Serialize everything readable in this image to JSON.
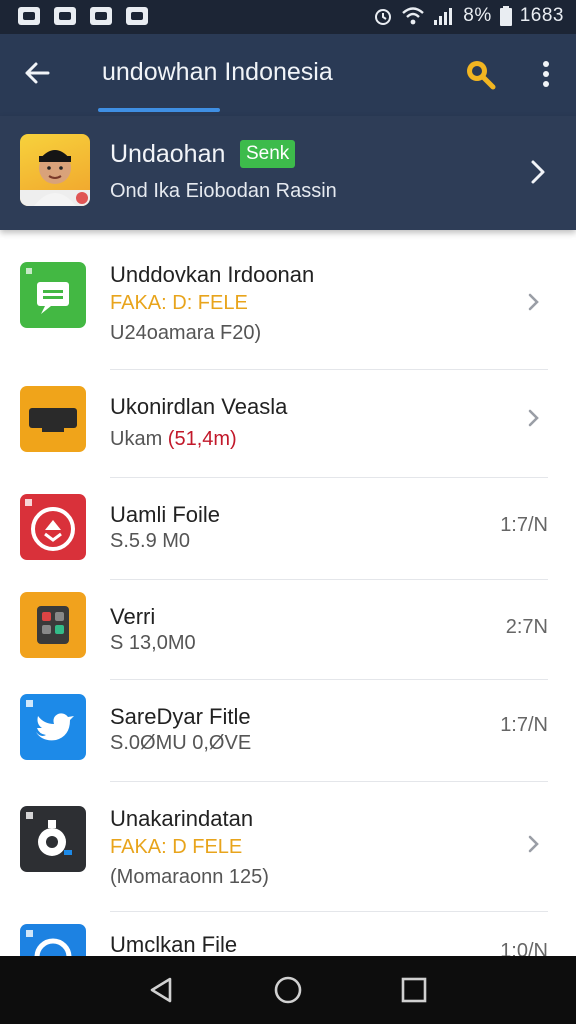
{
  "status_bar": {
    "battery": "8%",
    "time": "1683",
    "icons": [
      "notification-icon",
      "gallery-icon",
      "file-icon",
      "bag-icon",
      "alarm-icon",
      "wifi-icon",
      "signal-icon",
      "battery-icon"
    ]
  },
  "app_bar": {
    "title": "undowhan Indonesia",
    "back_icon": "arrow-left-icon",
    "search_icon": "search-icon",
    "more_icon": "more-vert-icon",
    "accent": "#3f8fe3"
  },
  "profile": {
    "name": "Undaohan",
    "badge": "Senk",
    "subtitle": "Ond Ika Eiobodan Rassin",
    "badge_color": "#3dbb4b"
  },
  "items": [
    {
      "title": "Unddovkan Irdoonan",
      "sub1": "FAKA: D: FELE",
      "sub2": "U24oamara F20)",
      "meta": "",
      "icon": "chat-icon",
      "color": "#43b843"
    },
    {
      "title": "Ukonirdlan Veasla",
      "sub1": "",
      "sub2": "Ukam",
      "sub2_highlight": "(51,4m)",
      "meta": "",
      "icon": "tv-icon",
      "color": "#f0a41a"
    },
    {
      "title": "Uamli Foile",
      "sub1": "",
      "sub2": "S.5.9 M0",
      "meta": "1:7/N",
      "icon": "download-badge-icon",
      "color": "#d9313a"
    },
    {
      "title": "Verri",
      "sub1": "",
      "sub2": "S 13,0M0",
      "meta": "2:7N",
      "icon": "calculator-icon",
      "color": "#f1a21d"
    },
    {
      "title": "SareDyar Fitle",
      "sub1": "",
      "sub2": "S.0ØMU 0,ØVE",
      "meta": "1:7/N",
      "icon": "twitter-bird-icon",
      "color": "#1d8ae8"
    },
    {
      "title": "Unakarindatan",
      "sub1": "FAKA: D FELE",
      "sub2": "(Momaraonn 125)",
      "meta": "",
      "icon": "camera-icon",
      "color": "#2d2f33"
    },
    {
      "title": "Umclkan File",
      "sub1": "",
      "sub2": "",
      "meta": "1:0/N",
      "icon": "blue-app-icon",
      "color": "#1d82e2"
    }
  ],
  "nav_bar": {
    "back": "nav-back-icon",
    "home": "nav-home-icon",
    "recents": "nav-recents-icon"
  }
}
